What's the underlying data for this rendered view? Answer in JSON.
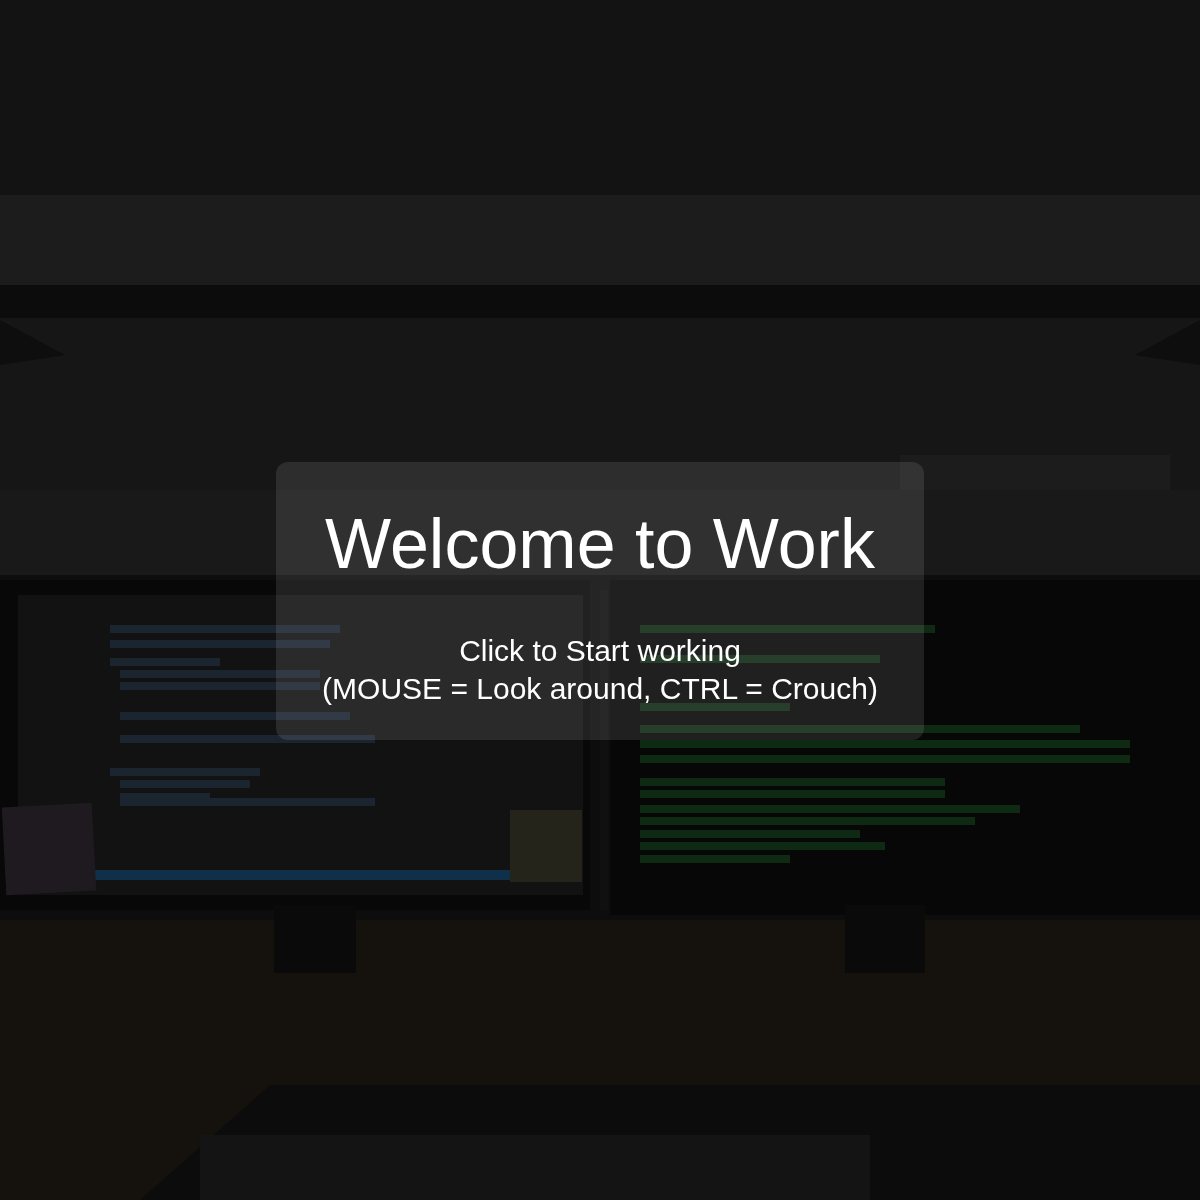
{
  "overlay": {
    "title": "Welcome to Work",
    "instructions": [
      "Click to Start working",
      "(MOUSE = Look around, CTRL = Crouch)"
    ]
  }
}
